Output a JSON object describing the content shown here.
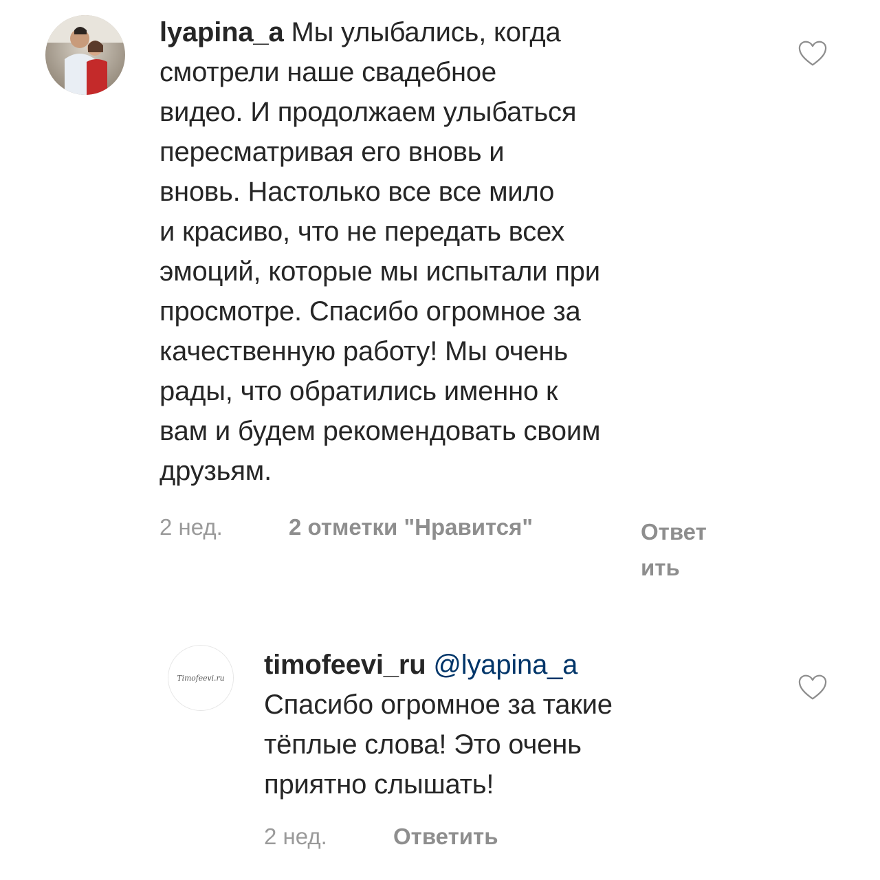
{
  "comments": [
    {
      "username": "lyapina_a",
      "text": " Мы улыбались, когда смотрели наше свадебное видео. И продолжаем улыбаться пересматривая его вновь и вновь. Настолько все все мило и красиво, что не передать всех эмоций, которые мы испытали при просмотре. Спасибо огромное за качественную работу! Мы очень рады, что обратились именно к вам и будем рекомендовать своим друзьям.",
      "lines": [
        " Мы улыбались, когда",
        "смотрели наше свадебное",
        "видео. И продолжаем улыбаться",
        "пересматривая его вновь и",
        "вновь. Настолько все все мило",
        "и красиво, что не передать всех",
        "эмоций, которые мы испытали при",
        "просмотре. Спасибо огромное за",
        "качественную работу! Мы очень",
        "рады, что обратились именно к",
        "вам и будем рекомендовать своим",
        "друзьям."
      ],
      "time": "2 нед.",
      "likes": "2 отметки \"Нравится\"",
      "reply_label_line1": "Ответ",
      "reply_label_line2": "ить",
      "like_icon": "heart-outline-icon"
    },
    {
      "username": "timofeevi_ru",
      "mention": "@lyapina_a",
      "lines": [
        "Спасибо огромное за такие",
        "тёплые слова! Это очень",
        "приятно слышать!"
      ],
      "avatar_text": "Timofeevi.ru",
      "time": "2 нед.",
      "reply_label": "Ответить",
      "like_icon": "heart-outline-icon"
    }
  ],
  "colors": {
    "text": "#262626",
    "meta": "#8e8e8e",
    "mention": "#003569",
    "background": "#ffffff"
  }
}
